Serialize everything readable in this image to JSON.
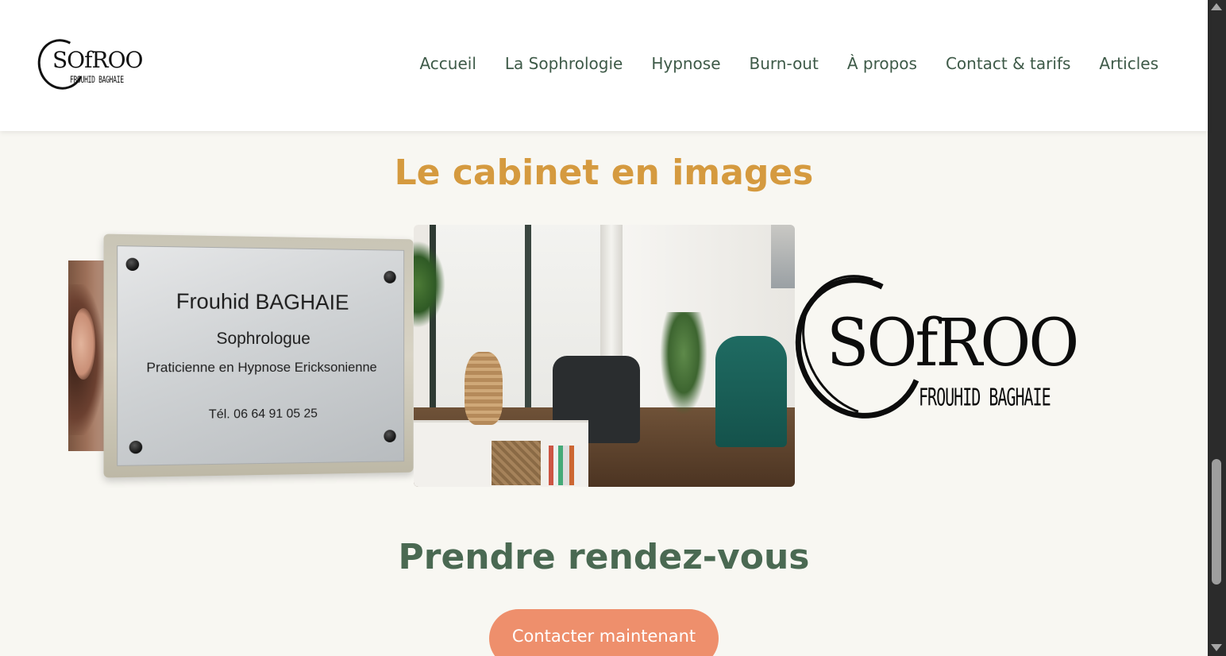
{
  "header": {
    "logo": {
      "word": "SOfROO",
      "subtitle": "FROUHID BAGHAIE"
    },
    "nav": [
      {
        "label": "Accueil"
      },
      {
        "label": "La Sophrologie"
      },
      {
        "label": "Hypnose"
      },
      {
        "label": "Burn-out"
      },
      {
        "label": "À propos"
      },
      {
        "label": "Contact & tarifs"
      },
      {
        "label": "Articles"
      }
    ]
  },
  "gallery": {
    "title": "Le cabinet en images",
    "plaque": {
      "name": "Frouhid BAGHAIE",
      "role": "Sophrologue",
      "specialty": "Praticienne en Hypnose Ericksonienne",
      "phone": "Tél. 06 64 91 05 25"
    },
    "logo_slide": {
      "word": "SOfROO",
      "subtitle": "FROUHID BAGHAIE"
    }
  },
  "booking": {
    "title": "Prendre rendez-vous",
    "cta_label": "Contacter maintenant"
  },
  "colors": {
    "nav_text": "#3e5a48",
    "gallery_title": "#d59a3f",
    "booking_title": "#4a6952",
    "cta_background": "#ee8f6c",
    "page_background": "#f8f7f2"
  }
}
